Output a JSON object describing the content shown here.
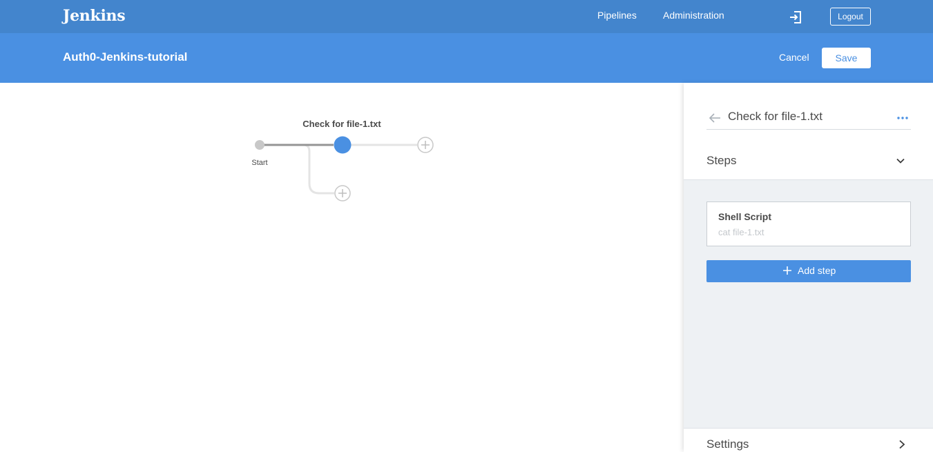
{
  "topnav": {
    "brand": "Jenkins",
    "links": [
      "Pipelines",
      "Administration"
    ],
    "logout_label": "Logout"
  },
  "subheader": {
    "pipeline_title": "Auth0-Jenkins-tutorial",
    "cancel_label": "Cancel",
    "save_label": "Save"
  },
  "graph": {
    "start_label": "Start",
    "stage_name": "Check for file-1.txt"
  },
  "panel": {
    "stage_title": "Check for file-1.txt",
    "steps_label": "Steps",
    "steps": [
      {
        "name": "Shell Script",
        "detail": "cat file-1.txt"
      }
    ],
    "add_step_label": "Add step",
    "settings_label": "Settings"
  },
  "colors": {
    "topnav_bg": "#4385cd",
    "subheader_bg": "#4a90e2",
    "accent": "#4a90e2",
    "panel_bg": "#eef1f4"
  }
}
